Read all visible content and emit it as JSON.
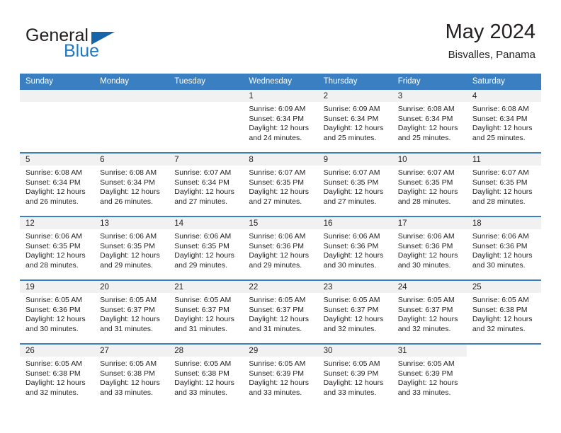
{
  "logo": {
    "word_one": "General",
    "word_two": "Blue",
    "triangle_icon": "triangle-icon",
    "color_dark": "#231f20",
    "color_blue": "#1f7ac4"
  },
  "header": {
    "title": "May 2024",
    "subtitle": "Bisvalles, Panama",
    "accent_color": "#3a7fc1",
    "daynum_bg": "#f1f1f1"
  },
  "calendar": {
    "weekday_headers": [
      "Sunday",
      "Monday",
      "Tuesday",
      "Wednesday",
      "Thursday",
      "Friday",
      "Saturday"
    ],
    "labels": {
      "sunrise": "Sunrise:",
      "sunset": "Sunset:",
      "daylight": "Daylight:"
    },
    "weeks": [
      [
        {
          "day": "",
          "empty": true
        },
        {
          "day": "",
          "empty": true
        },
        {
          "day": "",
          "empty": true
        },
        {
          "day": "1",
          "sunrise": "Sunrise: 6:09 AM",
          "sunset": "Sunset: 6:34 PM",
          "daylight_line1": "Daylight: 12 hours",
          "daylight_line2": "and 24 minutes."
        },
        {
          "day": "2",
          "sunrise": "Sunrise: 6:09 AM",
          "sunset": "Sunset: 6:34 PM",
          "daylight_line1": "Daylight: 12 hours",
          "daylight_line2": "and 25 minutes."
        },
        {
          "day": "3",
          "sunrise": "Sunrise: 6:08 AM",
          "sunset": "Sunset: 6:34 PM",
          "daylight_line1": "Daylight: 12 hours",
          "daylight_line2": "and 25 minutes."
        },
        {
          "day": "4",
          "sunrise": "Sunrise: 6:08 AM",
          "sunset": "Sunset: 6:34 PM",
          "daylight_line1": "Daylight: 12 hours",
          "daylight_line2": "and 25 minutes."
        }
      ],
      [
        {
          "day": "5",
          "sunrise": "Sunrise: 6:08 AM",
          "sunset": "Sunset: 6:34 PM",
          "daylight_line1": "Daylight: 12 hours",
          "daylight_line2": "and 26 minutes."
        },
        {
          "day": "6",
          "sunrise": "Sunrise: 6:08 AM",
          "sunset": "Sunset: 6:34 PM",
          "daylight_line1": "Daylight: 12 hours",
          "daylight_line2": "and 26 minutes."
        },
        {
          "day": "7",
          "sunrise": "Sunrise: 6:07 AM",
          "sunset": "Sunset: 6:34 PM",
          "daylight_line1": "Daylight: 12 hours",
          "daylight_line2": "and 27 minutes."
        },
        {
          "day": "8",
          "sunrise": "Sunrise: 6:07 AM",
          "sunset": "Sunset: 6:35 PM",
          "daylight_line1": "Daylight: 12 hours",
          "daylight_line2": "and 27 minutes."
        },
        {
          "day": "9",
          "sunrise": "Sunrise: 6:07 AM",
          "sunset": "Sunset: 6:35 PM",
          "daylight_line1": "Daylight: 12 hours",
          "daylight_line2": "and 27 minutes."
        },
        {
          "day": "10",
          "sunrise": "Sunrise: 6:07 AM",
          "sunset": "Sunset: 6:35 PM",
          "daylight_line1": "Daylight: 12 hours",
          "daylight_line2": "and 28 minutes."
        },
        {
          "day": "11",
          "sunrise": "Sunrise: 6:07 AM",
          "sunset": "Sunset: 6:35 PM",
          "daylight_line1": "Daylight: 12 hours",
          "daylight_line2": "and 28 minutes."
        }
      ],
      [
        {
          "day": "12",
          "sunrise": "Sunrise: 6:06 AM",
          "sunset": "Sunset: 6:35 PM",
          "daylight_line1": "Daylight: 12 hours",
          "daylight_line2": "and 28 minutes."
        },
        {
          "day": "13",
          "sunrise": "Sunrise: 6:06 AM",
          "sunset": "Sunset: 6:35 PM",
          "daylight_line1": "Daylight: 12 hours",
          "daylight_line2": "and 29 minutes."
        },
        {
          "day": "14",
          "sunrise": "Sunrise: 6:06 AM",
          "sunset": "Sunset: 6:35 PM",
          "daylight_line1": "Daylight: 12 hours",
          "daylight_line2": "and 29 minutes."
        },
        {
          "day": "15",
          "sunrise": "Sunrise: 6:06 AM",
          "sunset": "Sunset: 6:36 PM",
          "daylight_line1": "Daylight: 12 hours",
          "daylight_line2": "and 29 minutes."
        },
        {
          "day": "16",
          "sunrise": "Sunrise: 6:06 AM",
          "sunset": "Sunset: 6:36 PM",
          "daylight_line1": "Daylight: 12 hours",
          "daylight_line2": "and 30 minutes."
        },
        {
          "day": "17",
          "sunrise": "Sunrise: 6:06 AM",
          "sunset": "Sunset: 6:36 PM",
          "daylight_line1": "Daylight: 12 hours",
          "daylight_line2": "and 30 minutes."
        },
        {
          "day": "18",
          "sunrise": "Sunrise: 6:06 AM",
          "sunset": "Sunset: 6:36 PM",
          "daylight_line1": "Daylight: 12 hours",
          "daylight_line2": "and 30 minutes."
        }
      ],
      [
        {
          "day": "19",
          "sunrise": "Sunrise: 6:05 AM",
          "sunset": "Sunset: 6:36 PM",
          "daylight_line1": "Daylight: 12 hours",
          "daylight_line2": "and 30 minutes."
        },
        {
          "day": "20",
          "sunrise": "Sunrise: 6:05 AM",
          "sunset": "Sunset: 6:37 PM",
          "daylight_line1": "Daylight: 12 hours",
          "daylight_line2": "and 31 minutes."
        },
        {
          "day": "21",
          "sunrise": "Sunrise: 6:05 AM",
          "sunset": "Sunset: 6:37 PM",
          "daylight_line1": "Daylight: 12 hours",
          "daylight_line2": "and 31 minutes."
        },
        {
          "day": "22",
          "sunrise": "Sunrise: 6:05 AM",
          "sunset": "Sunset: 6:37 PM",
          "daylight_line1": "Daylight: 12 hours",
          "daylight_line2": "and 31 minutes."
        },
        {
          "day": "23",
          "sunrise": "Sunrise: 6:05 AM",
          "sunset": "Sunset: 6:37 PM",
          "daylight_line1": "Daylight: 12 hours",
          "daylight_line2": "and 32 minutes."
        },
        {
          "day": "24",
          "sunrise": "Sunrise: 6:05 AM",
          "sunset": "Sunset: 6:37 PM",
          "daylight_line1": "Daylight: 12 hours",
          "daylight_line2": "and 32 minutes."
        },
        {
          "day": "25",
          "sunrise": "Sunrise: 6:05 AM",
          "sunset": "Sunset: 6:38 PM",
          "daylight_line1": "Daylight: 12 hours",
          "daylight_line2": "and 32 minutes."
        }
      ],
      [
        {
          "day": "26",
          "sunrise": "Sunrise: 6:05 AM",
          "sunset": "Sunset: 6:38 PM",
          "daylight_line1": "Daylight: 12 hours",
          "daylight_line2": "and 32 minutes."
        },
        {
          "day": "27",
          "sunrise": "Sunrise: 6:05 AM",
          "sunset": "Sunset: 6:38 PM",
          "daylight_line1": "Daylight: 12 hours",
          "daylight_line2": "and 33 minutes."
        },
        {
          "day": "28",
          "sunrise": "Sunrise: 6:05 AM",
          "sunset": "Sunset: 6:38 PM",
          "daylight_line1": "Daylight: 12 hours",
          "daylight_line2": "and 33 minutes."
        },
        {
          "day": "29",
          "sunrise": "Sunrise: 6:05 AM",
          "sunset": "Sunset: 6:39 PM",
          "daylight_line1": "Daylight: 12 hours",
          "daylight_line2": "and 33 minutes."
        },
        {
          "day": "30",
          "sunrise": "Sunrise: 6:05 AM",
          "sunset": "Sunset: 6:39 PM",
          "daylight_line1": "Daylight: 12 hours",
          "daylight_line2": "and 33 minutes."
        },
        {
          "day": "31",
          "sunrise": "Sunrise: 6:05 AM",
          "sunset": "Sunset: 6:39 PM",
          "daylight_line1": "Daylight: 12 hours",
          "daylight_line2": "and 33 minutes."
        },
        {
          "day": "",
          "empty": true,
          "blank": true
        }
      ]
    ]
  }
}
